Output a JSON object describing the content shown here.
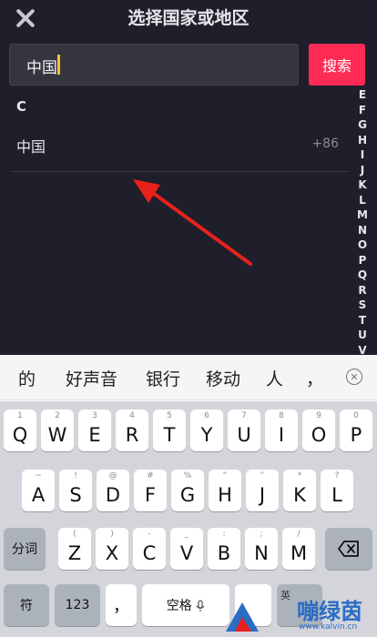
{
  "header": {
    "title": "选择国家或地区",
    "close_icon": "close-icon"
  },
  "search": {
    "value": "中国",
    "button_label": "搜索"
  },
  "list": {
    "section": "C",
    "items": [
      {
        "name": "中国",
        "code": "+86"
      }
    ]
  },
  "index_letters": [
    "E",
    "F",
    "G",
    "H",
    "I",
    "J",
    "K",
    "L",
    "M",
    "N",
    "O",
    "P",
    "Q",
    "R",
    "S",
    "T",
    "U",
    "V"
  ],
  "suggestions": {
    "items": [
      "的",
      "好声音",
      "银行",
      "移动",
      "人",
      "，"
    ],
    "dismiss_icon": "close-circle-icon"
  },
  "keyboard": {
    "row1": [
      {
        "main": "Q",
        "hint": "1"
      },
      {
        "main": "W",
        "hint": "2"
      },
      {
        "main": "E",
        "hint": "3"
      },
      {
        "main": "R",
        "hint": "4"
      },
      {
        "main": "T",
        "hint": "5"
      },
      {
        "main": "Y",
        "hint": "6"
      },
      {
        "main": "U",
        "hint": "7"
      },
      {
        "main": "I",
        "hint": "8"
      },
      {
        "main": "O",
        "hint": "9"
      },
      {
        "main": "P",
        "hint": "0"
      }
    ],
    "row2": [
      {
        "main": "A",
        "hint": "~"
      },
      {
        "main": "S",
        "hint": "!"
      },
      {
        "main": "D",
        "hint": "@"
      },
      {
        "main": "F",
        "hint": "#"
      },
      {
        "main": "G",
        "hint": "%"
      },
      {
        "main": "H",
        "hint": "“"
      },
      {
        "main": "J",
        "hint": "”"
      },
      {
        "main": "K",
        "hint": "*"
      },
      {
        "main": "L",
        "hint": "?"
      }
    ],
    "row3": [
      {
        "main": "Z",
        "hint": "("
      },
      {
        "main": "X",
        "hint": ")"
      },
      {
        "main": "C",
        "hint": "-"
      },
      {
        "main": "V",
        "hint": "_"
      },
      {
        "main": "B",
        "hint": ":"
      },
      {
        "main": "N",
        "hint": ";"
      },
      {
        "main": "M",
        "hint": "/"
      }
    ],
    "shift_label": "分词",
    "backspace_icon": "backspace-icon",
    "symbol_label": "符",
    "num_label": "123",
    "comma_label": "，",
    "space_label": "空格",
    "mic_icon": "microphone-icon",
    "lang_label": "英"
  },
  "watermark": {
    "text": "嘣绿茵",
    "url": "www.kalvin.cn"
  },
  "colors": {
    "accent": "#fe2c55",
    "background": "#1e1f2b",
    "caret": "#f5c428",
    "arrow": "#e8211d"
  }
}
